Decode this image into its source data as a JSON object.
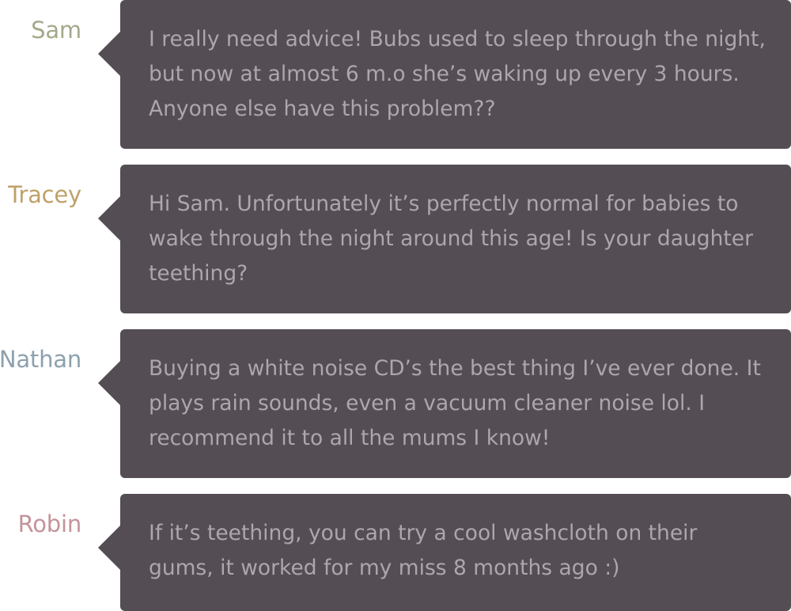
{
  "thread": {
    "messages": [
      {
        "author": "Sam",
        "author_color": "#a3a98a",
        "text": "I really need advice! Bubs used to sleep through the night, but now at almost 6 m.o she’s waking up every 3 hours. Anyone else have this problem??"
      },
      {
        "author": "Tracey",
        "author_color": "#bfa16a",
        "text": "Hi Sam. Unfortunately it’s perfectly normal for babies to wake through the night around this age! Is your daughter teething?"
      },
      {
        "author": "Nathan",
        "author_color": "#8ca1ad",
        "text": "Buying a white noise CD’s the best thing I’ve ever done. It plays rain sounds, even a vacuum cleaner noise lol. I recommend it to all the mums I know!"
      },
      {
        "author": "Robin",
        "author_color": "#c4939b",
        "text": "If it’s teething, you can try a cool washcloth on their gums, it worked for my miss 8 months ago :)"
      }
    ],
    "bubble_color": "#544d54",
    "bubble_text_color": "#ada6ad"
  }
}
